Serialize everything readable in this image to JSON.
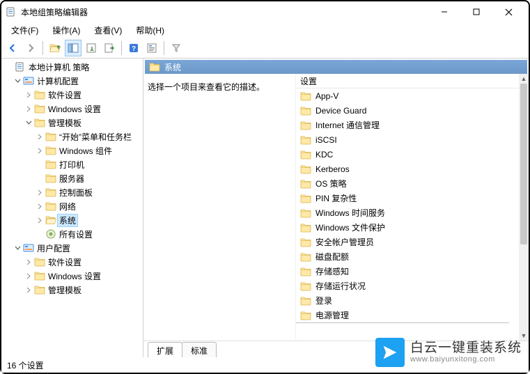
{
  "window": {
    "title": "本地组策略编辑器"
  },
  "menu": {
    "file": "文件(F)",
    "action": "操作(A)",
    "view": "查看(V)",
    "help": "帮助(H)"
  },
  "tree": {
    "root": "本地计算机 策略",
    "computerConfig": "计算机配置",
    "softwareSettings1": "软件设置",
    "windowsSettings1": "Windows 设置",
    "adminTemplates1": "管理模板",
    "startTaskbar": "“开始”菜单和任务栏",
    "windowsComponents": "Windows 组件",
    "printers": "打印机",
    "servers": "服务器",
    "controlPanel": "控制面板",
    "network": "网络",
    "system": "系统",
    "allSettings": "所有设置",
    "userConfig": "用户配置",
    "softwareSettings2": "软件设置",
    "windowsSettings2": "Windows 设置",
    "adminTemplates2": "管理模板"
  },
  "content": {
    "headerTitle": "系统",
    "descHint": "选择一个项目来查看它的描述。",
    "list": [
      "设置",
      "App-V",
      "Device Guard",
      "Internet 通信管理",
      "iSCSI",
      "KDC",
      "Kerberos",
      "OS 策略",
      "PIN 复杂性",
      "Windows 时间服务",
      "Windows 文件保护",
      "安全帐户管理员",
      "磁盘配额",
      "存储感知",
      "存储运行状况",
      "登录",
      "电源管理"
    ]
  },
  "tabs": {
    "extended": "扩展",
    "standard": "标准"
  },
  "status": {
    "left": "16 个设置"
  },
  "watermark": {
    "line1": "白云一键重装系统",
    "line2": "www.baiyunxitong.com"
  }
}
